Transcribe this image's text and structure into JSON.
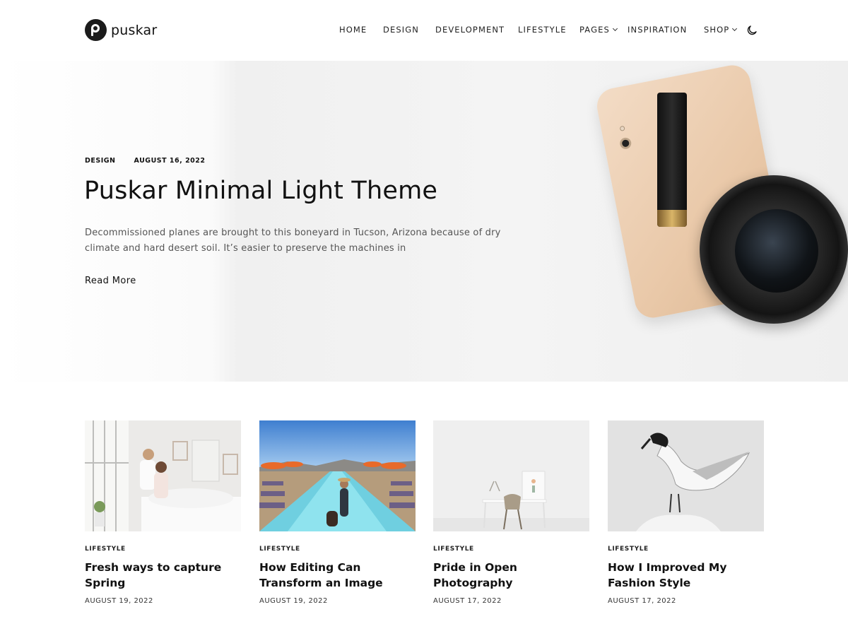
{
  "site": {
    "logo_text": "puskar",
    "logo_icon": "p-circle-logo-icon"
  },
  "nav": {
    "items": [
      {
        "label": "HOME",
        "dropdown": false
      },
      {
        "label": "DESIGN",
        "dropdown": false
      },
      {
        "label": "DEVELOPMENT",
        "dropdown": false
      },
      {
        "label": "LIFESTYLE",
        "dropdown": false
      },
      {
        "label": "PAGES",
        "dropdown": true
      },
      {
        "label": "INSPIRATION",
        "dropdown": false
      },
      {
        "label": "SHOP",
        "dropdown": true
      }
    ],
    "theme_toggle_icon": "moon-icon"
  },
  "hero": {
    "category": "DESIGN",
    "date": "AUGUST 16, 2022",
    "title": "Puskar Minimal Light Theme",
    "excerpt": "Decommissioned planes are brought to this boneyard in Tucson, Arizona because of dry climate and hard desert soil. It’s easier to preserve the machines in",
    "read_more": "Read More"
  },
  "posts": [
    {
      "category": "LIFESTYLE",
      "title": "Fresh ways to capture Spring",
      "date": "AUGUST 19, 2022",
      "image": "couple-bedroom-photo"
    },
    {
      "category": "LIFESTYLE",
      "title": "How Editing Can Transform an Image",
      "date": "AUGUST 19, 2022",
      "image": "pool-resort-photo"
    },
    {
      "category": "LIFESTYLE",
      "title": "Pride in Open Photography",
      "date": "AUGUST 17, 2022",
      "image": "minimal-desk-photo"
    },
    {
      "category": "LIFESTYLE",
      "title": "How I Improved My Fashion Style",
      "date": "AUGUST 17, 2022",
      "image": "tern-bird-photo"
    }
  ],
  "colors": {
    "text": "#111111",
    "muted": "#555555",
    "logo_bg": "#1b1b1b"
  }
}
